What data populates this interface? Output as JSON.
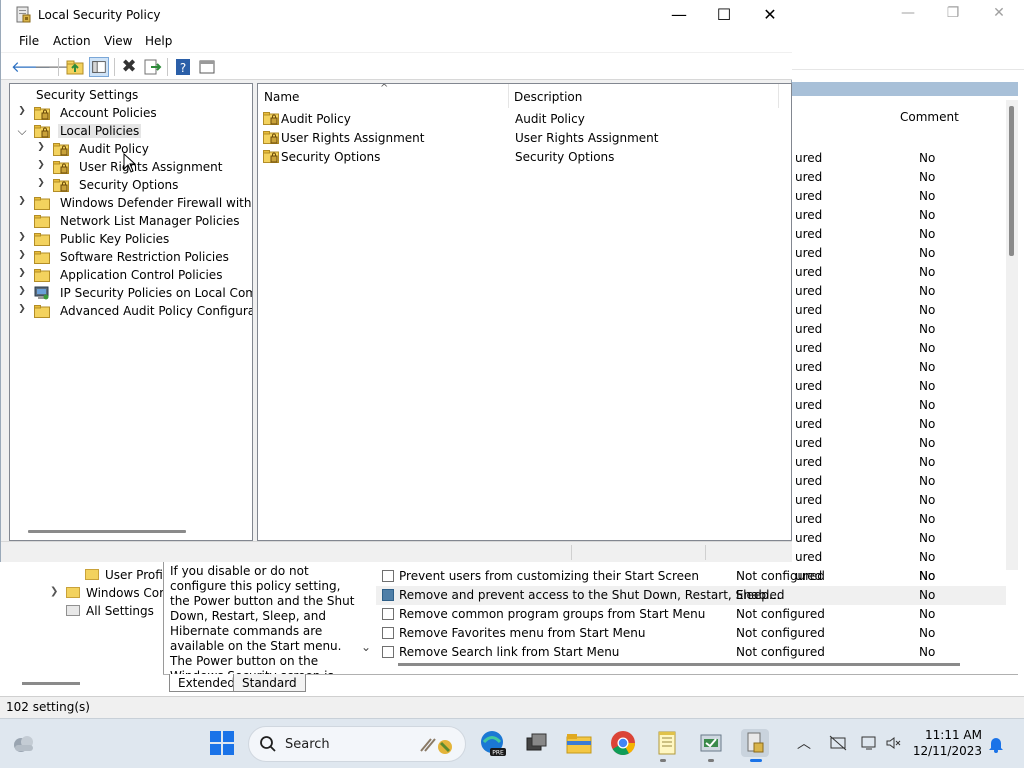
{
  "background_window": {
    "comment_header": "Comment",
    "setting_rows": [
      {
        "state": "ured",
        "comment": "No"
      },
      {
        "state": "ured",
        "comment": "No"
      },
      {
        "state": "ured",
        "comment": "No"
      },
      {
        "state": "ured",
        "comment": "No"
      },
      {
        "state": "ured",
        "comment": "No"
      },
      {
        "state": "ured",
        "comment": "No"
      },
      {
        "state": "ured",
        "comment": "No"
      },
      {
        "state": "ured",
        "comment": "No"
      },
      {
        "state": "ured",
        "comment": "No"
      },
      {
        "state": "ured",
        "comment": "No"
      },
      {
        "state": "ured",
        "comment": "No"
      },
      {
        "state": "ured",
        "comment": "No"
      },
      {
        "state": "ured",
        "comment": "No"
      },
      {
        "state": "ured",
        "comment": "No"
      },
      {
        "state": "ured",
        "comment": "No"
      },
      {
        "state": "ured",
        "comment": "No"
      },
      {
        "state": "ured",
        "comment": "No"
      },
      {
        "state": "ured",
        "comment": "No"
      },
      {
        "state": "ured",
        "comment": "No"
      },
      {
        "state": "ured",
        "comment": "No"
      },
      {
        "state": "ured",
        "comment": "No"
      },
      {
        "state": "ured",
        "comment": "No"
      },
      {
        "state": "ured",
        "comment": "No"
      }
    ],
    "tree_items": [
      "User Profi",
      "Windows Cor",
      "All Settings"
    ],
    "description": "If you disable or do not configure this policy setting, the Power button and the Shut Down, Restart, Sleep, and Hibernate commands are available on the Start menu. The Power button on the Windows Security screen is",
    "list_rows": [
      {
        "name": "Prevent users from customizing their Start Screen",
        "state": "Not configured",
        "comment": "No"
      },
      {
        "name": "Remove and prevent access to the Shut Down, Restart, Sleep...",
        "state": "Enabled",
        "comment": "No"
      },
      {
        "name": "Remove common program groups from Start Menu",
        "state": "Not configured",
        "comment": "No"
      },
      {
        "name": "Remove Favorites menu from Start Menu",
        "state": "Not configured",
        "comment": "No"
      },
      {
        "name": "Remove Search link from Start Menu",
        "state": "Not configured",
        "comment": "No"
      }
    ],
    "tabs": [
      "Extended",
      "Standard"
    ],
    "status": "102 setting(s)"
  },
  "window": {
    "title": "Local Security Policy",
    "controls": {
      "minimize": "—",
      "maximize": "☐",
      "close": "✕"
    },
    "menu": [
      "File",
      "Action",
      "View",
      "Help"
    ]
  },
  "tree": {
    "root": "Security Settings",
    "items": [
      "Account Policies",
      "Local Policies",
      "Audit Policy",
      "User Rights Assignment",
      "Security Options",
      "Windows Defender Firewall with Adva",
      "Network List Manager Policies",
      "Public Key Policies",
      "Software Restriction Policies",
      "Application Control Policies",
      "IP Security Policies on Local Compute",
      "Advanced Audit Policy Configuration"
    ]
  },
  "list": {
    "columns": {
      "name": "Name",
      "description": "Description"
    },
    "rows": [
      {
        "name": "Audit Policy",
        "description": "Audit Policy"
      },
      {
        "name": "User Rights Assignment",
        "description": "User Rights Assignment"
      },
      {
        "name": "Security Options",
        "description": "Security Options"
      }
    ]
  },
  "taskbar": {
    "search_label": "Search",
    "time": "11:11 AM",
    "date": "12/11/2023"
  },
  "colors": {
    "taskbar": "#dfe7ef",
    "folder": "#f3d25e",
    "window_bg": "#f0f0f0",
    "selection": "#e5e5e5"
  }
}
